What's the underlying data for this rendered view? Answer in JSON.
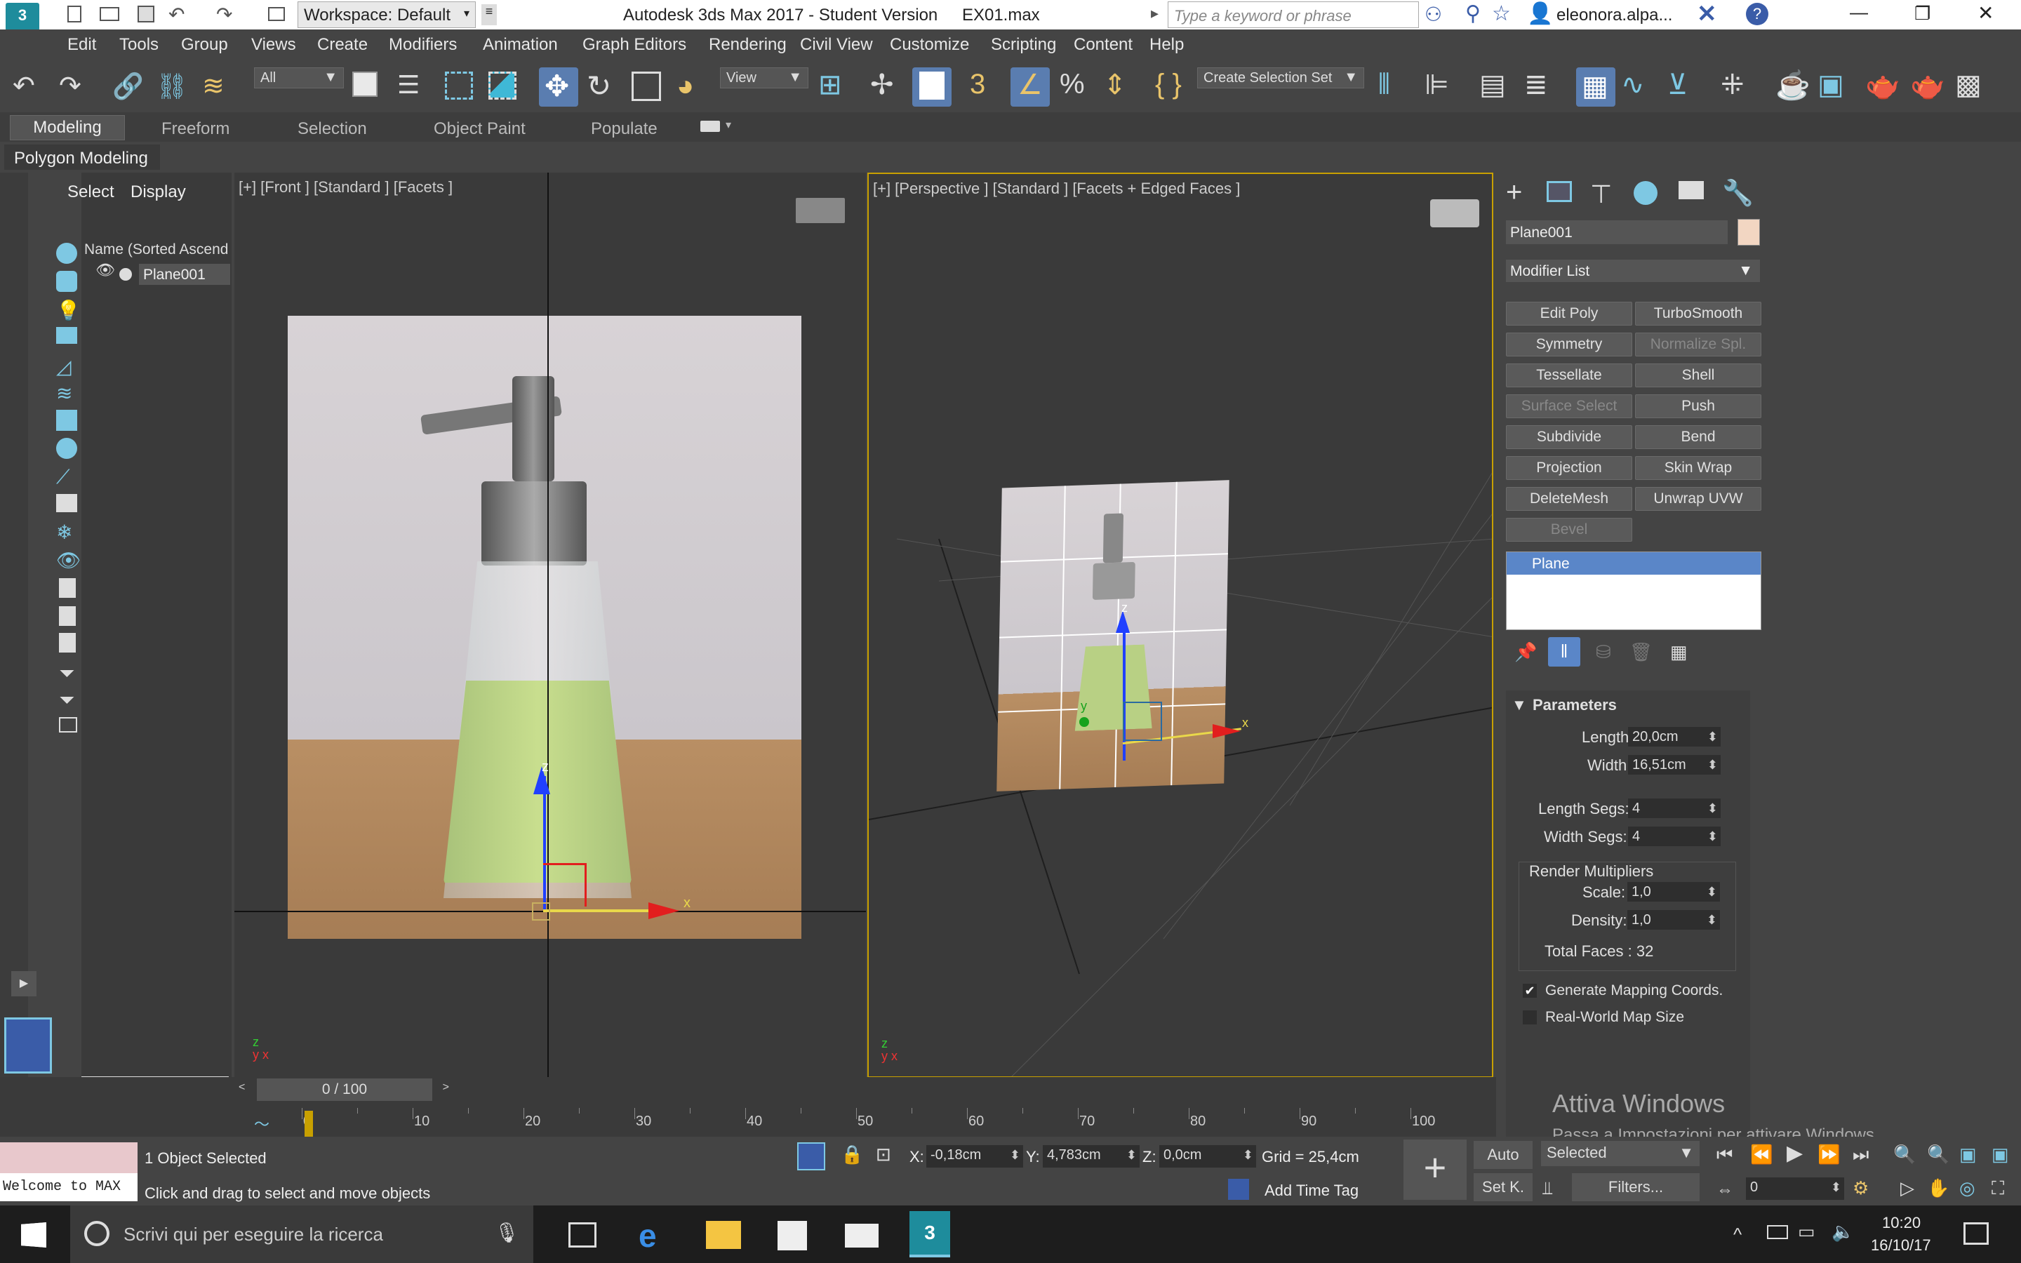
{
  "titlebar": {
    "workspace": "Workspace: Default",
    "title": "Autodesk 3ds Max 2017 - Student Version",
    "filename": "EX01.max",
    "search_placeholder": "Type a keyword or phrase",
    "user": "eleonora.alpa..."
  },
  "menu": [
    "Edit",
    "Tools",
    "Group",
    "Views",
    "Create",
    "Modifiers",
    "Animation",
    "Graph Editors",
    "Rendering",
    "Civil View",
    "Customize",
    "Scripting",
    "Content",
    "Help"
  ],
  "toolbar": {
    "filter": "All",
    "ref_coord": "View",
    "selection_set": "Create Selection Set"
  },
  "ribbon": {
    "tabs": [
      "Modeling",
      "Freeform",
      "Selection",
      "Object Paint",
      "Populate"
    ],
    "sub": "Polygon Modeling"
  },
  "scene_explorer": {
    "tabs": [
      "Select",
      "Display"
    ],
    "header": "Name (Sorted Ascend",
    "item": "Plane001"
  },
  "viewports": {
    "front_label": "[+]  [Front ]  [Standard ]  [Facets ]",
    "persp_label": "[+]  [Perspective ]  [Standard ]  [Facets + Edged Faces ]",
    "axis_x": "x",
    "axis_y": "y",
    "axis_z": "z"
  },
  "command_panel": {
    "object_name": "Plane001",
    "object_color": "#f2d6c2",
    "modifier_list": "Modifier List",
    "modifiers": [
      {
        "label": "Edit Poly",
        "disabled": false
      },
      {
        "label": "TurboSmooth",
        "disabled": false
      },
      {
        "label": "Symmetry",
        "disabled": false
      },
      {
        "label": "Normalize Spl.",
        "disabled": true
      },
      {
        "label": "Tessellate",
        "disabled": false
      },
      {
        "label": "Shell",
        "disabled": false
      },
      {
        "label": "Surface Select",
        "disabled": true
      },
      {
        "label": "Push",
        "disabled": false
      },
      {
        "label": "Subdivide",
        "disabled": false
      },
      {
        "label": "Bend",
        "disabled": false
      },
      {
        "label": "Projection",
        "disabled": false
      },
      {
        "label": "Skin Wrap",
        "disabled": false
      },
      {
        "label": "DeleteMesh",
        "disabled": false
      },
      {
        "label": "Unwrap UVW",
        "disabled": false
      },
      {
        "label": "Bevel",
        "disabled": true
      }
    ],
    "stack_item": "Plane",
    "params_title": "Parameters",
    "length_label": "Length:",
    "length": "20,0cm",
    "width_label": "Width:",
    "width": "16,51cm",
    "length_segs_label": "Length Segs:",
    "length_segs": "4",
    "width_segs_label": "Width Segs:",
    "width_segs": "4",
    "render_mult": "Render Multipliers",
    "scale_label": "Scale:",
    "scale": "1,0",
    "density_label": "Density:",
    "density": "1,0",
    "total_faces": "Total Faces : 32",
    "gen_mapping": "Generate Mapping Coords.",
    "gen_mapping_checked": true,
    "real_world": "Real-World Map Size",
    "real_world_checked": false
  },
  "timeline": {
    "frame": "0 / 100",
    "ticks": [
      "0",
      "10",
      "20",
      "30",
      "40",
      "50",
      "60",
      "70",
      "80",
      "90",
      "100"
    ]
  },
  "status": {
    "maxscript": "Welcome to MAX",
    "selected": "1 Object Selected",
    "prompt": "Click and drag to select and move objects",
    "x_label": "X:",
    "x": "-0,18cm",
    "y_label": "Y:",
    "y": "4,783cm",
    "z_label": "Z:",
    "z": "0,0cm",
    "grid": "Grid = 25,4cm",
    "add_time_tag": "Add Time Tag",
    "auto": "Auto",
    "set_key": "Set K.",
    "selected_dd": "Selected",
    "filters": "Filters...",
    "frame_field": "0"
  },
  "watermark": {
    "line1": "Attiva Windows",
    "line2": "Passa a Impostazioni per attivare Windows."
  },
  "taskbar": {
    "search": "Scrivi qui per eseguire la ricerca",
    "time": "10:20",
    "date": "16/10/17"
  }
}
